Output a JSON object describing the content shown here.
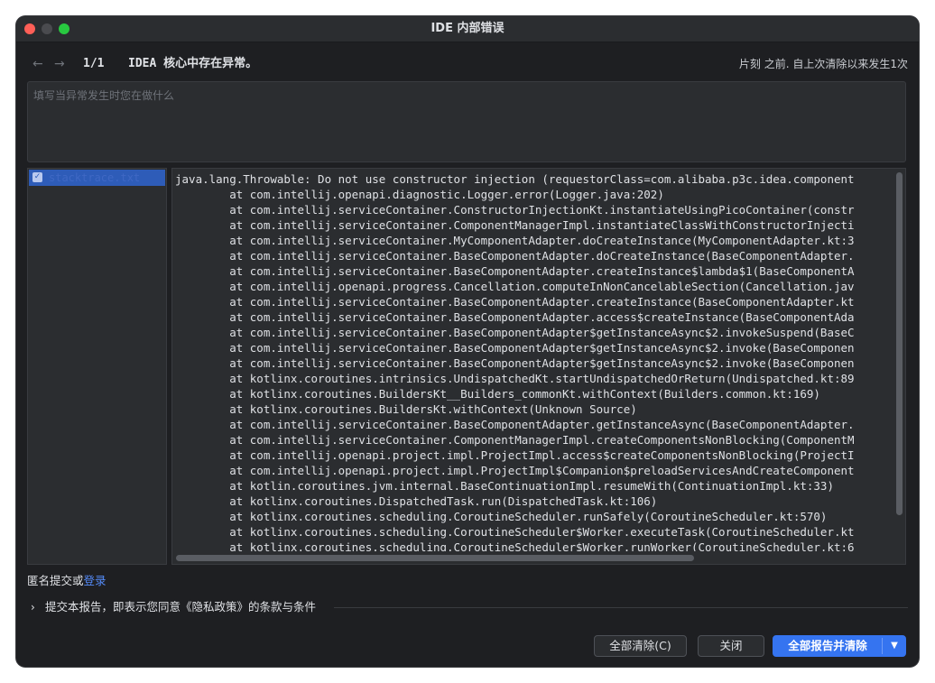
{
  "window": {
    "title": "IDE 内部错误"
  },
  "nav": {
    "counter": "1/1",
    "message": "IDEA 核心中存在异常。",
    "time_info": "片刻 之前. 自上次清除以来发生1次"
  },
  "comment": {
    "placeholder": "填写当异常发生时您在做什么"
  },
  "attachments": [
    {
      "name": "stacktrace.txt",
      "checked": true
    }
  ],
  "stacktrace": [
    "java.lang.Throwable: Do not use constructor injection (requestorClass=com.alibaba.p3c.idea.component",
    "\tat com.intellij.openapi.diagnostic.Logger.error(Logger.java:202)",
    "\tat com.intellij.serviceContainer.ConstructorInjectionKt.instantiateUsingPicoContainer(constr",
    "\tat com.intellij.serviceContainer.ComponentManagerImpl.instantiateClassWithConstructorInjecti",
    "\tat com.intellij.serviceContainer.MyComponentAdapter.doCreateInstance(MyComponentAdapter.kt:3",
    "\tat com.intellij.serviceContainer.BaseComponentAdapter.doCreateInstance(BaseComponentAdapter.",
    "\tat com.intellij.serviceContainer.BaseComponentAdapter.createInstance$lambda$1(BaseComponentA",
    "\tat com.intellij.openapi.progress.Cancellation.computeInNonCancelableSection(Cancellation.jav",
    "\tat com.intellij.serviceContainer.BaseComponentAdapter.createInstance(BaseComponentAdapter.kt",
    "\tat com.intellij.serviceContainer.BaseComponentAdapter.access$createInstance(BaseComponentAda",
    "\tat com.intellij.serviceContainer.BaseComponentAdapter$getInstanceAsync$2.invokeSuspend(BaseC",
    "\tat com.intellij.serviceContainer.BaseComponentAdapter$getInstanceAsync$2.invoke(BaseComponen",
    "\tat com.intellij.serviceContainer.BaseComponentAdapter$getInstanceAsync$2.invoke(BaseComponen",
    "\tat kotlinx.coroutines.intrinsics.UndispatchedKt.startUndispatchedOrReturn(Undispatched.kt:89",
    "\tat kotlinx.coroutines.BuildersKt__Builders_commonKt.withContext(Builders.common.kt:169)",
    "\tat kotlinx.coroutines.BuildersKt.withContext(Unknown Source)",
    "\tat com.intellij.serviceContainer.BaseComponentAdapter.getInstanceAsync(BaseComponentAdapter.",
    "\tat com.intellij.serviceContainer.ComponentManagerImpl.createComponentsNonBlocking(ComponentM",
    "\tat com.intellij.openapi.project.impl.ProjectImpl.access$createComponentsNonBlocking(ProjectI",
    "\tat com.intellij.openapi.project.impl.ProjectImpl$Companion$preloadServicesAndCreateComponent",
    "\tat kotlin.coroutines.jvm.internal.BaseContinuationImpl.resumeWith(ContinuationImpl.kt:33)",
    "\tat kotlinx.coroutines.DispatchedTask.run(DispatchedTask.kt:106)",
    "\tat kotlinx.coroutines.scheduling.CoroutineScheduler.runSafely(CoroutineScheduler.kt:570)",
    "\tat kotlinx.coroutines.scheduling.CoroutineScheduler$Worker.executeTask(CoroutineScheduler.kt",
    "\tat kotlinx.coroutines.scheduling.CoroutineScheduler$Worker.runWorker(CoroutineScheduler.kt:6"
  ],
  "anonymous": {
    "text": "匿名提交或",
    "login": "登录"
  },
  "consent": {
    "text": "提交本报告，即表示您同意《隐私政策》的条款与条件"
  },
  "buttons": {
    "clear_all": "全部清除(C)",
    "close": "关闭",
    "report_all": "全部报告并清除"
  },
  "colors": {
    "accent": "#3574f0",
    "link": "#548af7",
    "background": "#1e1f22"
  }
}
